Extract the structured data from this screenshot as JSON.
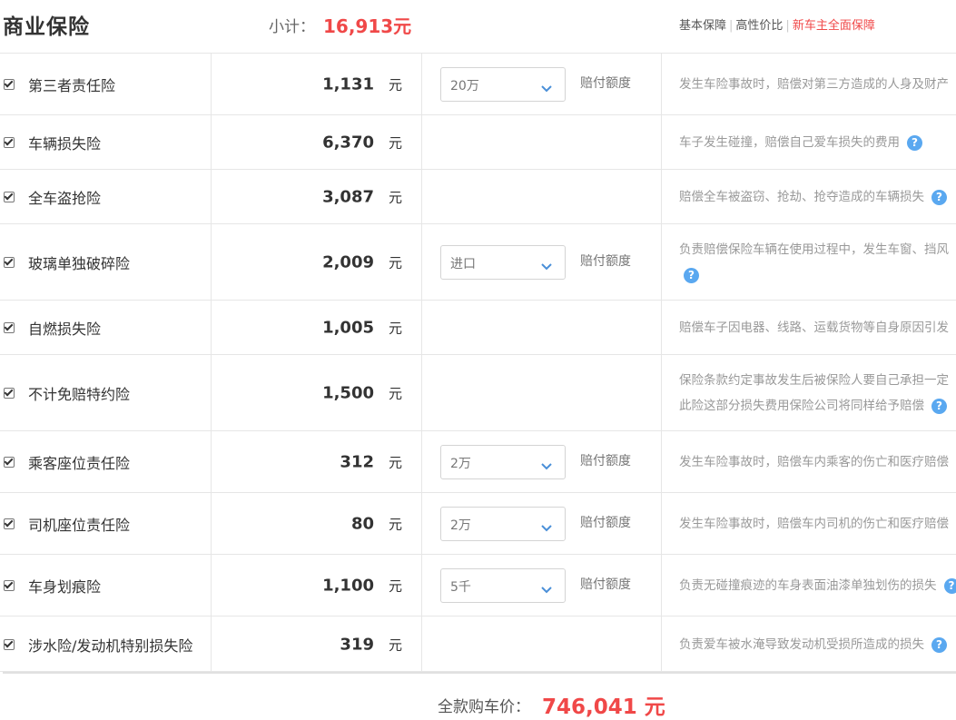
{
  "header": {
    "title": "商业保险",
    "subtotal_label": "小计：",
    "subtotal_value": "16,913元",
    "plans": [
      "基本保障",
      "高性价比",
      "新车主全面保障"
    ]
  },
  "rows": [
    {
      "name": "第三者责任险",
      "price": "1,131",
      "unit": "元",
      "select": "20万",
      "amount_label": "赔付额度",
      "desc": [
        "发生车险事故时，赔偿对第三方造成的人身及财产"
      ]
    },
    {
      "name": "车辆损失险",
      "price": "6,370",
      "unit": "元",
      "select": "",
      "amount_label": "",
      "desc": [
        "车子发生碰撞，赔偿自己爱车损失的费用"
      ]
    },
    {
      "name": "全车盗抢险",
      "price": "3,087",
      "unit": "元",
      "select": "",
      "amount_label": "",
      "desc": [
        "赔偿全车被盗窃、抢劫、抢夺造成的车辆损失"
      ]
    },
    {
      "name": "玻璃单独破碎险",
      "price": "2,009",
      "unit": "元",
      "select": "进口",
      "amount_label": "赔付额度",
      "desc": [
        "负责赔偿保险车辆在使用过程中，发生车窗、挡风",
        ""
      ]
    },
    {
      "name": "自燃损失险",
      "price": "1,005",
      "unit": "元",
      "select": "",
      "amount_label": "",
      "desc": [
        "赔偿车子因电器、线路、运载货物等自身原因引发"
      ]
    },
    {
      "name": "不计免赔特约险",
      "price": "1,500",
      "unit": "元",
      "select": "",
      "amount_label": "",
      "desc": [
        "保险条款约定事故发生后被保险人要自己承担一定",
        "此险这部分损失费用保险公司将同样给予赔偿"
      ]
    },
    {
      "name": "乘客座位责任险",
      "price": "312",
      "unit": "元",
      "select": "2万",
      "amount_label": "赔付额度",
      "desc": [
        "发生车险事故时，赔偿车内乘客的伤亡和医疗赔偿"
      ]
    },
    {
      "name": "司机座位责任险",
      "price": "80",
      "unit": "元",
      "select": "2万",
      "amount_label": "赔付额度",
      "desc": [
        "发生车险事故时，赔偿车内司机的伤亡和医疗赔偿"
      ]
    },
    {
      "name": "车身划痕险",
      "price": "1,100",
      "unit": "元",
      "select": "5千",
      "amount_label": "赔付额度",
      "desc": [
        "负责无碰撞痕迹的车身表面油漆单独划伤的损失"
      ]
    },
    {
      "name": "涉水险/发动机特别损失险",
      "price": "319",
      "unit": "元",
      "select": "",
      "amount_label": "",
      "desc": [
        "负责爱车被水淹导致发动机受损所造成的损失"
      ]
    }
  ],
  "help_icon": "?",
  "footer": {
    "total_label": "全款购车价：",
    "total_value": "746,041 元"
  },
  "colors": {
    "accent": "#f04848",
    "help": "#5aa8f0"
  }
}
